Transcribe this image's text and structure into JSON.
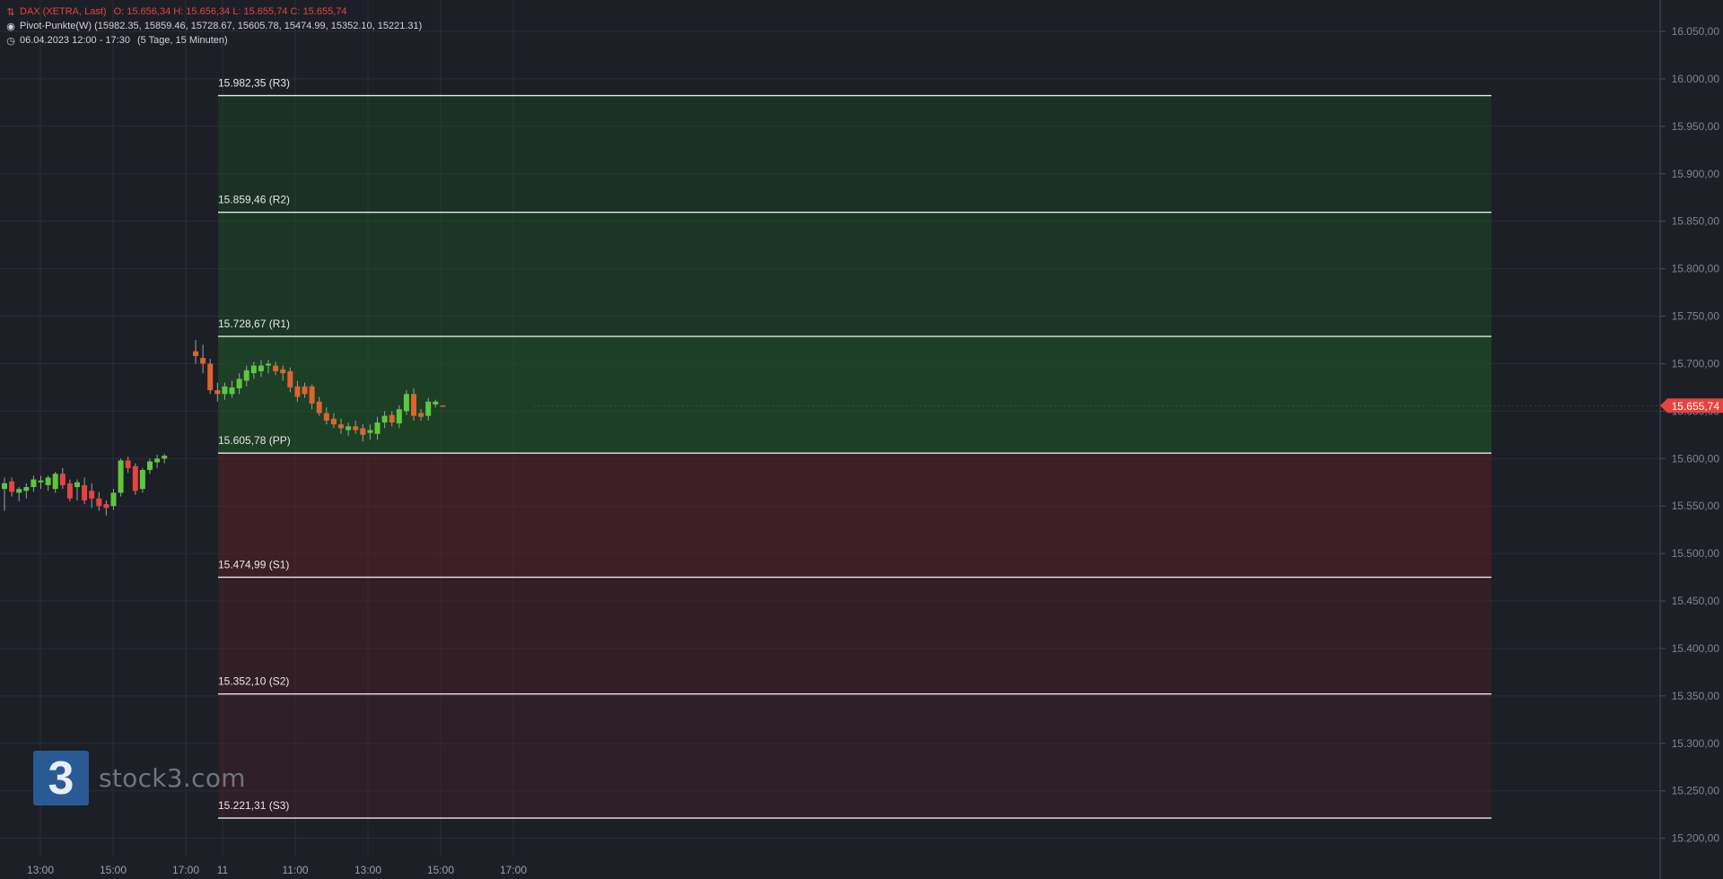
{
  "legend": {
    "instrument": "DAX (XETRA, Last)",
    "ohlc": "O: 15.656,34  H: 15.656,34  L: 15.655,74  C: 15.655,74",
    "indicator": "Pivot-Punkte(W)  (15982.35,  15859.46,  15728.67,  15605.78,  15474.99,  15352.10,  15221.31)",
    "period_date": "06.04.2023 12:00 - 17:30",
    "period_range": "(5 Tage, 15 Minuten)"
  },
  "logo": {
    "mark": "3",
    "text": "stock3.com"
  },
  "colors": {
    "background": "#1c1f26",
    "up": "#5cc93a",
    "down": "#e8433f",
    "down_alt": "#e0632a",
    "zone_green": "#1d5a24",
    "zone_red": "#5a1f26",
    "price_tag": "#e8433f"
  },
  "chart_data": {
    "type": "candlestick",
    "ylim": [
      15180,
      16070
    ],
    "y_ticks": [
      16050,
      16000,
      15950,
      15900,
      15850,
      15800,
      15750,
      15700,
      15650,
      15600,
      15550,
      15500,
      15450,
      15400,
      15350,
      15300,
      15250,
      15200
    ],
    "y_tick_labels": [
      "16.050,00",
      "16.000,00",
      "15.950,00",
      "15.900,00",
      "15.850,00",
      "15.800,00",
      "15.750,00",
      "15.700,00",
      "15.650,00",
      "15.600,00",
      "15.550,00",
      "15.500,00",
      "15.450,00",
      "15.400,00",
      "15.350,00",
      "15.300,00",
      "15.250,00",
      "15.200,00"
    ],
    "x_labels": [
      "13:00",
      "15:00",
      "17:00",
      "11",
      "11:00",
      "13:00",
      "15:00",
      "17:00"
    ],
    "last_price": 15655.74,
    "last_price_label": "15.655,74",
    "pivots": [
      {
        "label": "15.982,35 (R3)",
        "value": 15982.35
      },
      {
        "label": "15.859,46 (R2)",
        "value": 15859.46
      },
      {
        "label": "15.728,67 (R1)",
        "value": 15728.67
      },
      {
        "label": "15.605,78 (PP)",
        "value": 15605.78
      },
      {
        "label": "15.474,99 (S1)",
        "value": 15474.99
      },
      {
        "label": "15.352,10 (S2)",
        "value": 15352.1
      },
      {
        "label": "15.221,31 (S3)",
        "value": 15221.31
      }
    ],
    "candles": [
      {
        "o": 15568,
        "h": 15580,
        "l": 15545,
        "c": 15574
      },
      {
        "o": 15576,
        "h": 15580,
        "l": 15560,
        "c": 15565
      },
      {
        "o": 15564,
        "h": 15570,
        "l": 15555,
        "c": 15568
      },
      {
        "o": 15566,
        "h": 15574,
        "l": 15558,
        "c": 15570
      },
      {
        "o": 15570,
        "h": 15582,
        "l": 15565,
        "c": 15578
      },
      {
        "o": 15575,
        "h": 15582,
        "l": 15568,
        "c": 15577
      },
      {
        "o": 15572,
        "h": 15582,
        "l": 15566,
        "c": 15580
      },
      {
        "o": 15568,
        "h": 15586,
        "l": 15564,
        "c": 15584
      },
      {
        "o": 15584,
        "h": 15590,
        "l": 15568,
        "c": 15572
      },
      {
        "o": 15574,
        "h": 15578,
        "l": 15555,
        "c": 15558
      },
      {
        "o": 15570,
        "h": 15578,
        "l": 15556,
        "c": 15575
      },
      {
        "o": 15572,
        "h": 15580,
        "l": 15552,
        "c": 15556
      },
      {
        "o": 15566,
        "h": 15574,
        "l": 15548,
        "c": 15558
      },
      {
        "o": 15558,
        "h": 15565,
        "l": 15545,
        "c": 15550
      },
      {
        "o": 15552,
        "h": 15556,
        "l": 15540,
        "c": 15548
      },
      {
        "o": 15550,
        "h": 15568,
        "l": 15546,
        "c": 15564
      },
      {
        "o": 15564,
        "h": 15600,
        "l": 15560,
        "c": 15598
      },
      {
        "o": 15598,
        "h": 15602,
        "l": 15585,
        "c": 15590
      },
      {
        "o": 15592,
        "h": 15595,
        "l": 15562,
        "c": 15566
      },
      {
        "o": 15568,
        "h": 15590,
        "l": 15564,
        "c": 15588
      },
      {
        "o": 15588,
        "h": 15600,
        "l": 15584,
        "c": 15597
      },
      {
        "o": 15596,
        "h": 15604,
        "l": 15590,
        "c": 15600
      },
      {
        "o": 15600,
        "h": 15605,
        "l": 15595,
        "c": 15603
      },
      {
        "o": 15713,
        "h": 15725,
        "l": 15700,
        "c": 15708
      },
      {
        "o": 15706,
        "h": 15720,
        "l": 15690,
        "c": 15700
      },
      {
        "o": 15700,
        "h": 15705,
        "l": 15668,
        "c": 15672
      },
      {
        "o": 15672,
        "h": 15680,
        "l": 15660,
        "c": 15668
      },
      {
        "o": 15668,
        "h": 15680,
        "l": 15662,
        "c": 15676
      },
      {
        "o": 15668,
        "h": 15682,
        "l": 15664,
        "c": 15675
      },
      {
        "o": 15674,
        "h": 15690,
        "l": 15668,
        "c": 15684
      },
      {
        "o": 15682,
        "h": 15698,
        "l": 15676,
        "c": 15693
      },
      {
        "o": 15690,
        "h": 15702,
        "l": 15684,
        "c": 15698
      },
      {
        "o": 15692,
        "h": 15704,
        "l": 15686,
        "c": 15698
      },
      {
        "o": 15698,
        "h": 15704,
        "l": 15690,
        "c": 15700
      },
      {
        "o": 15698,
        "h": 15702,
        "l": 15688,
        "c": 15692
      },
      {
        "o": 15694,
        "h": 15698,
        "l": 15682,
        "c": 15690
      },
      {
        "o": 15692,
        "h": 15696,
        "l": 15670,
        "c": 15675
      },
      {
        "o": 15676,
        "h": 15682,
        "l": 15660,
        "c": 15665
      },
      {
        "o": 15676,
        "h": 15680,
        "l": 15664,
        "c": 15668
      },
      {
        "o": 15676,
        "h": 15678,
        "l": 15652,
        "c": 15658
      },
      {
        "o": 15660,
        "h": 15665,
        "l": 15645,
        "c": 15648
      },
      {
        "o": 15648,
        "h": 15654,
        "l": 15636,
        "c": 15640
      },
      {
        "o": 15642,
        "h": 15648,
        "l": 15632,
        "c": 15636
      },
      {
        "o": 15636,
        "h": 15642,
        "l": 15626,
        "c": 15632
      },
      {
        "o": 15630,
        "h": 15638,
        "l": 15624,
        "c": 15634
      },
      {
        "o": 15634,
        "h": 15640,
        "l": 15626,
        "c": 15630
      },
      {
        "o": 15632,
        "h": 15636,
        "l": 15618,
        "c": 15625
      },
      {
        "o": 15627,
        "h": 15636,
        "l": 15620,
        "c": 15630
      },
      {
        "o": 15626,
        "h": 15644,
        "l": 15620,
        "c": 15638
      },
      {
        "o": 15638,
        "h": 15650,
        "l": 15632,
        "c": 15645
      },
      {
        "o": 15646,
        "h": 15650,
        "l": 15634,
        "c": 15638
      },
      {
        "o": 15637,
        "h": 15656,
        "l": 15632,
        "c": 15652
      },
      {
        "o": 15650,
        "h": 15672,
        "l": 15646,
        "c": 15668
      },
      {
        "o": 15668,
        "h": 15674,
        "l": 15640,
        "c": 15645
      },
      {
        "o": 15648,
        "h": 15652,
        "l": 15640,
        "c": 15644
      },
      {
        "o": 15645,
        "h": 15664,
        "l": 15640,
        "c": 15660
      },
      {
        "o": 15657,
        "h": 15662,
        "l": 15654,
        "c": 15660
      },
      {
        "o": 15656,
        "h": 15656,
        "l": 15655,
        "c": 15655.74
      }
    ]
  }
}
